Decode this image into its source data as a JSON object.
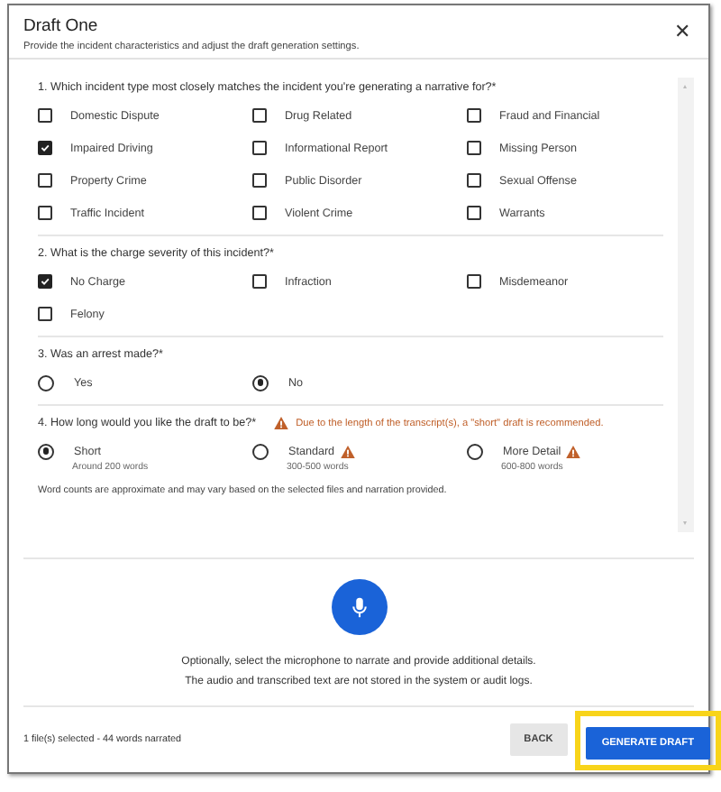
{
  "dialog": {
    "title": "Draft One",
    "subtitle": "Provide the incident characteristics and adjust the draft generation settings.",
    "close": "✕"
  },
  "questions": [
    {
      "kind": "checkbox",
      "label": "1. Which incident type most closely matches the incident you're generating a narrative for?*",
      "options": [
        {
          "label": "Domestic Dispute",
          "checked": false
        },
        {
          "label": "Drug Related",
          "checked": false
        },
        {
          "label": "Fraud and Financial",
          "checked": false
        },
        {
          "label": "Impaired Driving",
          "checked": true
        },
        {
          "label": "Informational Report",
          "checked": false
        },
        {
          "label": "Missing Person",
          "checked": false
        },
        {
          "label": "Property Crime",
          "checked": false
        },
        {
          "label": "Public Disorder",
          "checked": false
        },
        {
          "label": "Sexual Offense",
          "checked": false
        },
        {
          "label": "Traffic Incident",
          "checked": false
        },
        {
          "label": "Violent Crime",
          "checked": false
        },
        {
          "label": "Warrants",
          "checked": false
        }
      ]
    },
    {
      "kind": "checkbox",
      "label": "2. What is the charge severity of this incident?*",
      "options": [
        {
          "label": "No Charge",
          "checked": true
        },
        {
          "label": "Infraction",
          "checked": false
        },
        {
          "label": "Misdemeanor",
          "checked": false
        },
        {
          "label": "Felony",
          "checked": false
        }
      ]
    },
    {
      "kind": "radio",
      "label": "3. Was an arrest made?*",
      "options": [
        {
          "label": "Yes",
          "selected": false
        },
        {
          "label": "No",
          "selected": true
        }
      ]
    },
    {
      "kind": "radio",
      "label": "4. How long would you like the draft to be?*",
      "warning": "Due to the length of the transcript(s), a \"short\" draft is recommended.",
      "options": [
        {
          "label": "Short",
          "hint": "Around 200 words",
          "selected": true,
          "warned": false
        },
        {
          "label": "Standard",
          "hint": "300-500 words",
          "selected": false,
          "warned": true
        },
        {
          "label": "More Detail",
          "hint": "600-800 words",
          "selected": false,
          "warned": true
        }
      ],
      "note": "Word counts are approximate and may vary based on the selected files and narration provided."
    }
  ],
  "narration": {
    "lines": [
      "Optionally, select the microphone to narrate and provide additional details.",
      "The audio and transcribed text are not stored in the system or audit logs."
    ]
  },
  "footer": {
    "status": "1 file(s) selected - 44 words narrated",
    "buttons": [
      {
        "label": "BACK",
        "kind": "secondary",
        "highlighted": false
      },
      {
        "label": "GENERATE DRAFT",
        "kind": "primary",
        "highlighted": true
      }
    ]
  }
}
